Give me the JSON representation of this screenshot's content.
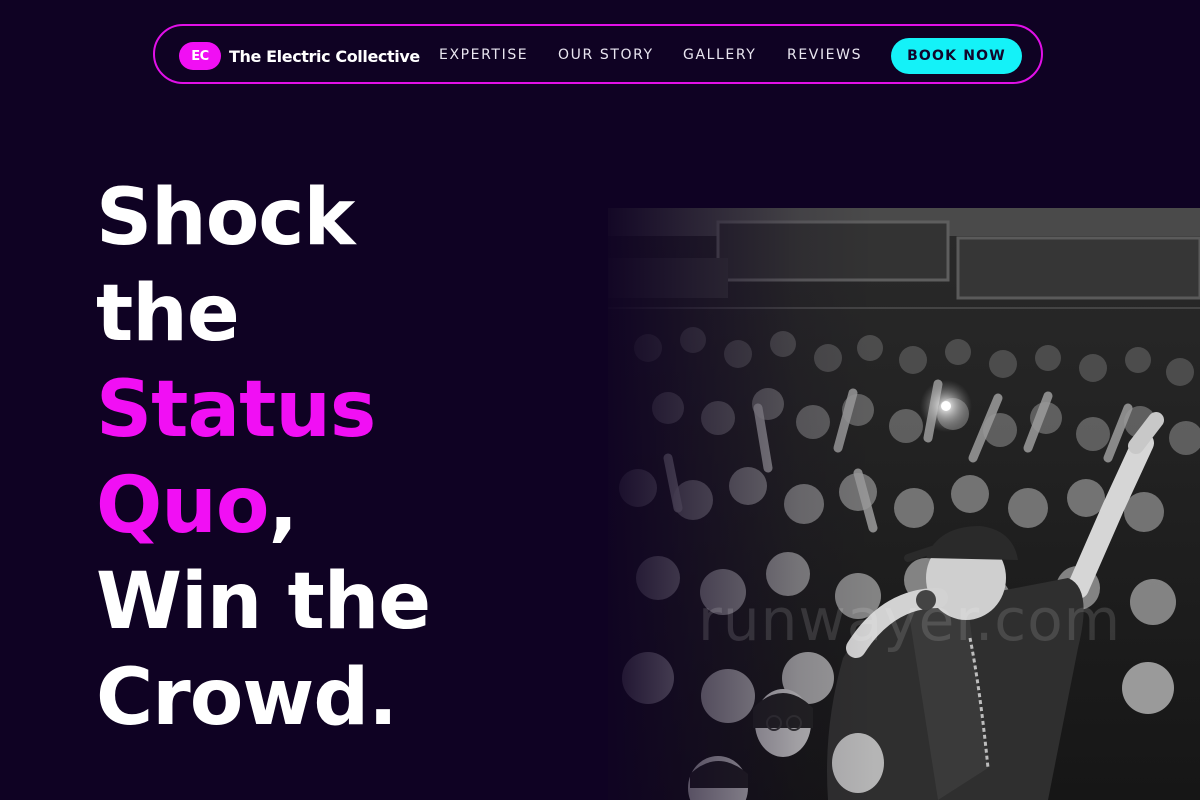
{
  "nav": {
    "brand_badge": "EC",
    "brand_name": "The Electric Collective",
    "links": [
      {
        "label": "EXPERTISE"
      },
      {
        "label": "OUR STORY"
      },
      {
        "label": "GALLERY"
      },
      {
        "label": "REVIEWS"
      }
    ],
    "cta_label": "BOOK NOW"
  },
  "hero": {
    "line1": "Shock",
    "line2": "the",
    "line3": "Status",
    "line4_accent": "Quo",
    "line4_rest": ",",
    "line5": "Win the",
    "line6": "Crowd."
  },
  "image": {
    "watermark": "runwayer.com"
  },
  "colors": {
    "background": "#0f0223",
    "accent_magenta": "#f10ff4",
    "accent_cyan": "#14f2f8",
    "text": "#ffffff"
  }
}
